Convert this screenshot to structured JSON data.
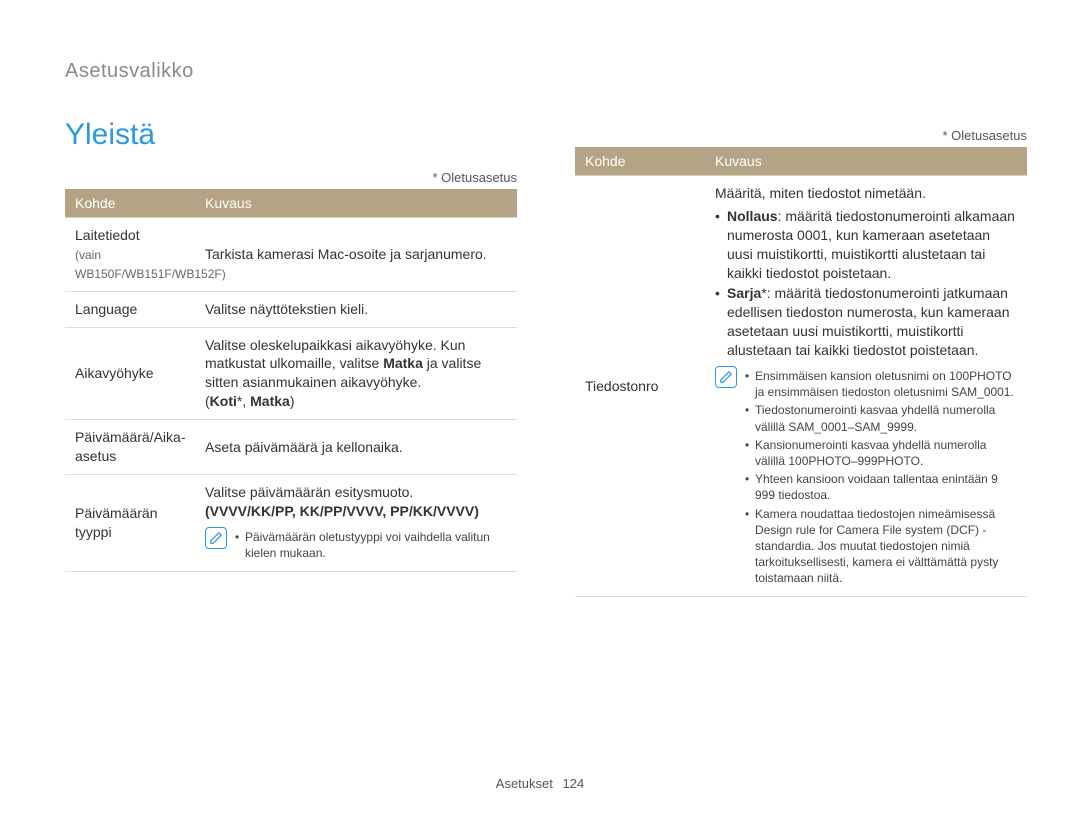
{
  "breadcrumb": "Asetusvalikko",
  "section_title": "Yleistä",
  "default_note": "* Oletusasetus",
  "headers": {
    "kohde": "Kohde",
    "kuvaus": "Kuvaus"
  },
  "left_rows": [
    {
      "kohde": "Laitetiedot",
      "kohde_sub": "(vain WB150F/WB151F/WB152F)",
      "kuvaus": "Tarkista kamerasi Mac-osoite ja sarjanumero."
    },
    {
      "kohde": "Language",
      "kuvaus": "Valitse näyttötekstien kieli."
    },
    {
      "kohde": "Aikavyöhyke",
      "kuvaus_lines": [
        "Valitse oleskelupaikkasi aikavyöhyke. Kun matkustat ulkomaille, valitse ",
        "Matka",
        " ja valitse sitten asianmukainen aikavyöhyke."
      ],
      "options": "(Koti*, Matka)"
    },
    {
      "kohde": "Päivämäärä/Aika-asetus",
      "kuvaus": "Aseta päivämäärä ja kellonaika."
    },
    {
      "kohde": "Päivämäärän tyyppi",
      "kuvaus": "Valitse päivämäärän esitysmuoto.",
      "options": "(VVVV/KK/PP, KK/PP/VVVV, PP/KK/VVVV)",
      "note": "Päivämäärän oletustyyppi voi vaihdella valitun kielen mukaan."
    }
  ],
  "right_row": {
    "kohde": "Tiedostonro",
    "intro": "Määritä, miten tiedostot nimetään.",
    "bullets": [
      {
        "head": "Nollaus",
        "rest": ": määritä tiedostonumerointi alkamaan numerosta 0001, kun kameraan asetetaan uusi muistikortti, muistikortti alustetaan tai kaikki tiedostot poistetaan."
      },
      {
        "head": "Sarja",
        "star": "*",
        "rest": ": määritä tiedostonumerointi jatkumaan edellisen tiedoston numerosta, kun kameraan asetetaan uusi muistikortti, muistikortti alustetaan tai kaikki tiedostot poistetaan."
      }
    ],
    "notes": [
      "Ensimmäisen kansion oletusnimi on 100PHOTO ja ensimmäisen tiedoston oletusnimi SAM_0001.",
      "Tiedostonumerointi kasvaa yhdellä numerolla välillä SAM_0001–SAM_9999.",
      "Kansionumerointi kasvaa yhdellä numerolla välillä 100PHOTO–999PHOTO.",
      "Yhteen kansioon voidaan tallentaa enintään 9 999 tiedostoa.",
      "Kamera noudattaa tiedostojen nimeämisessä Design rule for Camera File system (DCF) -standardia. Jos muutat tiedostojen nimiä tarkoituksellisesti, kamera ei välttämättä pysty toistamaan niitä."
    ]
  },
  "footer": {
    "section": "Asetukset",
    "page": "124"
  }
}
